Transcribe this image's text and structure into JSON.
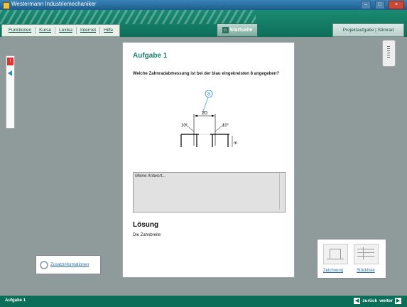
{
  "window": {
    "title": "Westermann Industriemechaniker"
  },
  "menu": {
    "items": [
      "Funktionen",
      "Kurse",
      "Lexika",
      "Internet",
      "Hilfe"
    ]
  },
  "header": {
    "start_label": "Startseite",
    "project_label": "Projektaufgabe | Stirnrad"
  },
  "task": {
    "title": "Aufgabe 1",
    "question": "Welche Zahnradabmessung ist bei der blau eingekreisten 8 angegeben?",
    "drawing": {
      "callout": "8",
      "dimension": "20",
      "angle_left": "10°",
      "angle_right": "10°",
      "radius": "m"
    },
    "answer_placeholder": "Meine Antwort...",
    "solution_title": "Lösung",
    "solution_text": "Die Zahnbreite"
  },
  "extra": {
    "zusatz_label": "Zusatzinformationen"
  },
  "media": {
    "items": [
      "Zeichnung",
      "Stückliste"
    ]
  },
  "status": {
    "current": "Aufgabe 1",
    "back": "zurück",
    "next": "weiter"
  },
  "colors": {
    "brand": "#0e6e58",
    "accent": "#16816a",
    "link": "#2b6fa0"
  }
}
